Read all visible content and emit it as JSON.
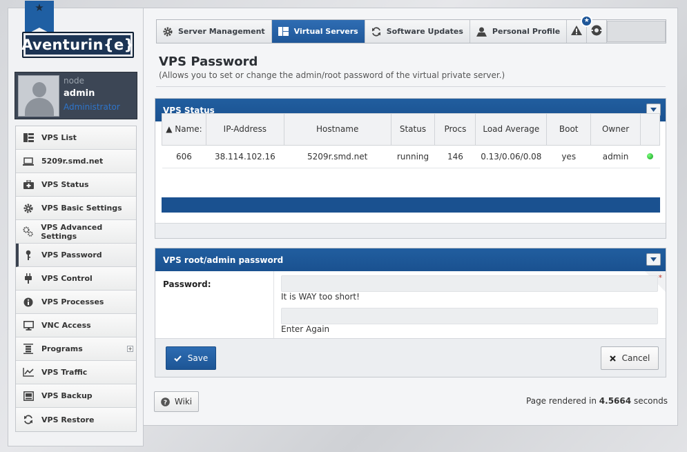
{
  "brand": {
    "logo_text": "Aventurin{e}",
    "ribbon_icon": "star-icon"
  },
  "user": {
    "server": "node",
    "name": "admin",
    "role": "Administrator"
  },
  "sidebar": {
    "items": [
      {
        "label": "VPS List",
        "icon": "list-icon"
      },
      {
        "label": "5209r.smd.net",
        "icon": "laptop-icon"
      },
      {
        "label": "VPS Status",
        "icon": "medkit-icon"
      },
      {
        "label": "VPS Basic Settings",
        "icon": "gear-icon"
      },
      {
        "label": "VPS Advanced Settings",
        "icon": "gears-icon"
      },
      {
        "label": "VPS Password",
        "icon": "key-icon",
        "active": true
      },
      {
        "label": "VPS Control",
        "icon": "plug-icon"
      },
      {
        "label": "VPS Processes",
        "icon": "info-icon"
      },
      {
        "label": "VNC Access",
        "icon": "monitor-icon"
      },
      {
        "label": "Programs",
        "icon": "abacus-icon",
        "expandable": true
      },
      {
        "label": "VPS Traffic",
        "icon": "chart-icon"
      },
      {
        "label": "VPS Backup",
        "icon": "backup-icon"
      },
      {
        "label": "VPS Restore",
        "icon": "refresh-icon"
      }
    ]
  },
  "tabs": [
    {
      "label": "Server Management",
      "icon": "gear-icon"
    },
    {
      "label": "Virtual Servers",
      "icon": "layout-icon",
      "active": true
    },
    {
      "label": "Software Updates",
      "icon": "refresh-icon"
    },
    {
      "label": "Personal Profile",
      "icon": "user-icon"
    }
  ],
  "alerts": {
    "badge": "★"
  },
  "page": {
    "title": "VPS Password",
    "subtitle": "(Allows you to set or change the admin/root password of the virtual private server.)"
  },
  "status_panel": {
    "title": "VPS Status",
    "columns": [
      "▲ Name:",
      "IP-Address",
      "Hostname",
      "Status",
      "Procs",
      "Load Average",
      "Boot",
      "Owner",
      ""
    ],
    "row": {
      "name": "606",
      "ip": "38.114.102.16",
      "hostname": "5209r.smd.net",
      "status": "running",
      "procs": "146",
      "load": "0.13/0.06/0.08",
      "boot": "yes",
      "owner": "admin"
    }
  },
  "password_panel": {
    "title": "VPS root/admin password",
    "label": "Password:",
    "hint_first": "It is WAY too short!",
    "hint_second": "Enter Again",
    "required_mark": "*",
    "save_label": "Save",
    "cancel_label": "Cancel"
  },
  "footer": {
    "wiki_label": "Wiki",
    "rendered_prefix": "Page rendered in",
    "rendered_time": "4.5664",
    "rendered_suffix": "seconds"
  },
  "colors": {
    "accent": "#1f5799",
    "panel_header": "#1a5190",
    "status_ok": "#0b9a1c"
  }
}
